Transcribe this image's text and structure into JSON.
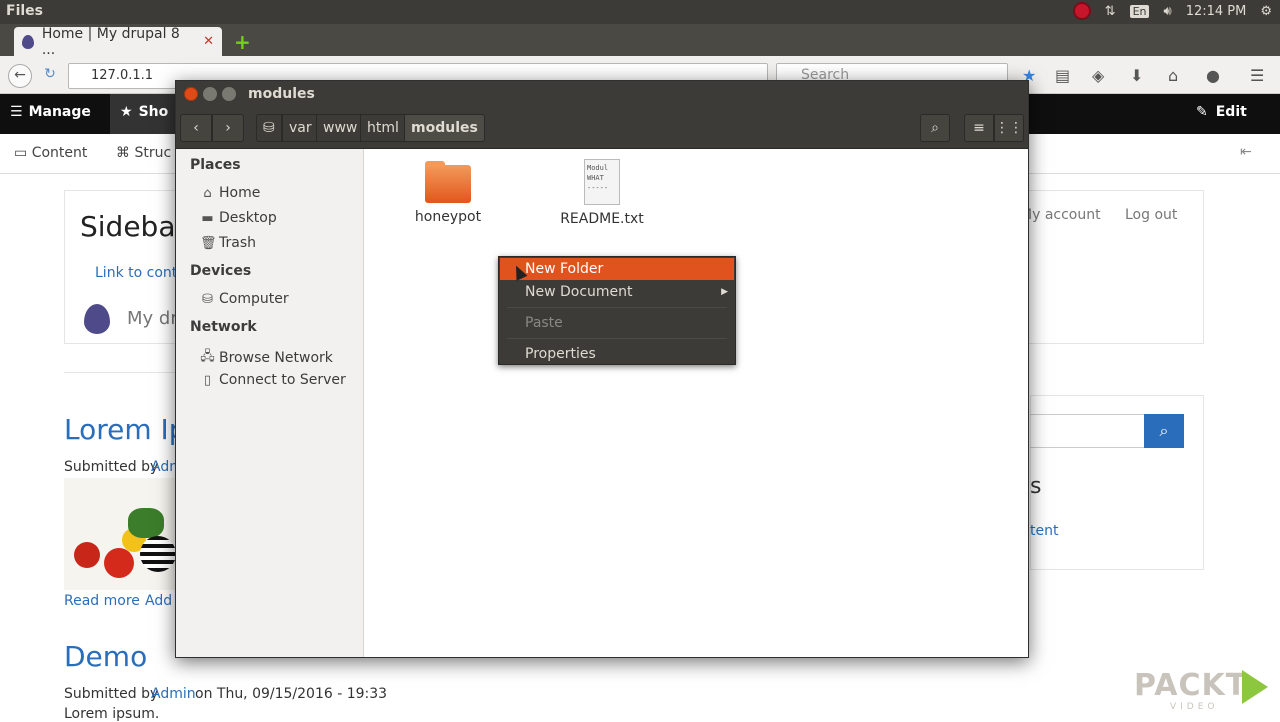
{
  "topbar": {
    "app": "Files",
    "lang": "En",
    "time": "12:14 PM"
  },
  "browser": {
    "tab_title": "Home | My drupal 8 ...",
    "url": "127.0.1.1",
    "search_placeholder": "Search"
  },
  "drupal": {
    "manage": "Manage",
    "shortcuts": "Sho",
    "edit": "Edit",
    "content": "Content",
    "structure": "Struc",
    "my_account": "My account",
    "logout": "Log out",
    "sidebar_heading": "Sideba",
    "link_to_content": "Link to conte",
    "site_name": "My dru",
    "article1_title": "Lorem Ip",
    "submitted_by": "Submitted by",
    "admin_short": "Adm",
    "read_more": "Read more",
    "add": "Add",
    "article2_title": "Demo",
    "submitted_line": "on Thu, 09/15/2016 - 19:33",
    "admin": "Admin",
    "lorem": "Lorem ipsum.",
    "right_s": "s",
    "right_link": "tent"
  },
  "nautilus": {
    "title": "modules",
    "breadcrumbs": [
      "var",
      "www",
      "html",
      "modules"
    ],
    "places_heading": "Places",
    "places": [
      "Home",
      "Desktop",
      "Trash"
    ],
    "devices_heading": "Devices",
    "devices": [
      "Computer"
    ],
    "network_heading": "Network",
    "network": [
      "Browse Network",
      "Connect to Server"
    ],
    "files": [
      {
        "name": "honeypot",
        "type": "folder"
      },
      {
        "name": "README.txt",
        "type": "text",
        "preview": [
          "Modul",
          "WHAT",
          "-----"
        ]
      }
    ]
  },
  "context_menu": {
    "items": [
      {
        "label": "New Folder",
        "state": "highlighted"
      },
      {
        "label": "New Document",
        "state": "submenu"
      },
      {
        "label": "Paste",
        "state": "disabled"
      },
      {
        "label": "Properties",
        "state": "normal"
      }
    ]
  },
  "watermark": {
    "brand": "PACKT",
    "sub": "VIDEO"
  }
}
